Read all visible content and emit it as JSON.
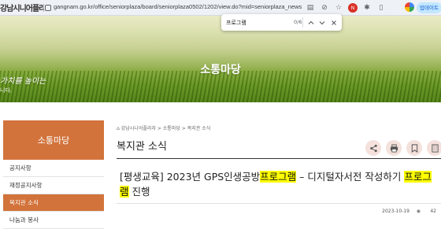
{
  "browser": {
    "site_fragment": "강남시니어플라자",
    "url": "gangnam.go.kr/office/seniorplaza/board/seniorplaza0502/1202/view.do?mid=seniorplaza_news",
    "update_label": "업데이트"
  },
  "find_bar": {
    "query": "프로그램",
    "count": "0/6"
  },
  "hero": {
    "title": "소통마당",
    "slogan": "가치를 높이는",
    "slogan_sub": "니다."
  },
  "sidebar": {
    "header": "소통마당",
    "items": [
      {
        "label": "공지사항",
        "active": false
      },
      {
        "label": "재정공지사항",
        "active": false
      },
      {
        "label": "복지관 소식",
        "active": true
      },
      {
        "label": "나눔과 봉사",
        "active": false
      }
    ]
  },
  "breadcrumb": {
    "home": "강남시니어플라자",
    "sep1": ">",
    "level1": "소통마당",
    "sep2": ">",
    "current": "복지관 소식"
  },
  "page": {
    "title": "복지관 소식"
  },
  "post": {
    "title_part1": "[평생교육] 2023년 GPS인생공방",
    "highlight1": "프로그램",
    "title_part2": " – 디지털자서전 작성하기 ",
    "highlight2": "프로그램",
    "title_part3": " 진행",
    "date": "2023-10-19",
    "views": "42"
  },
  "colors": {
    "accent": "#d2733b",
    "highlight": "#ffff00",
    "tool_bg": "#f4e1dc"
  }
}
